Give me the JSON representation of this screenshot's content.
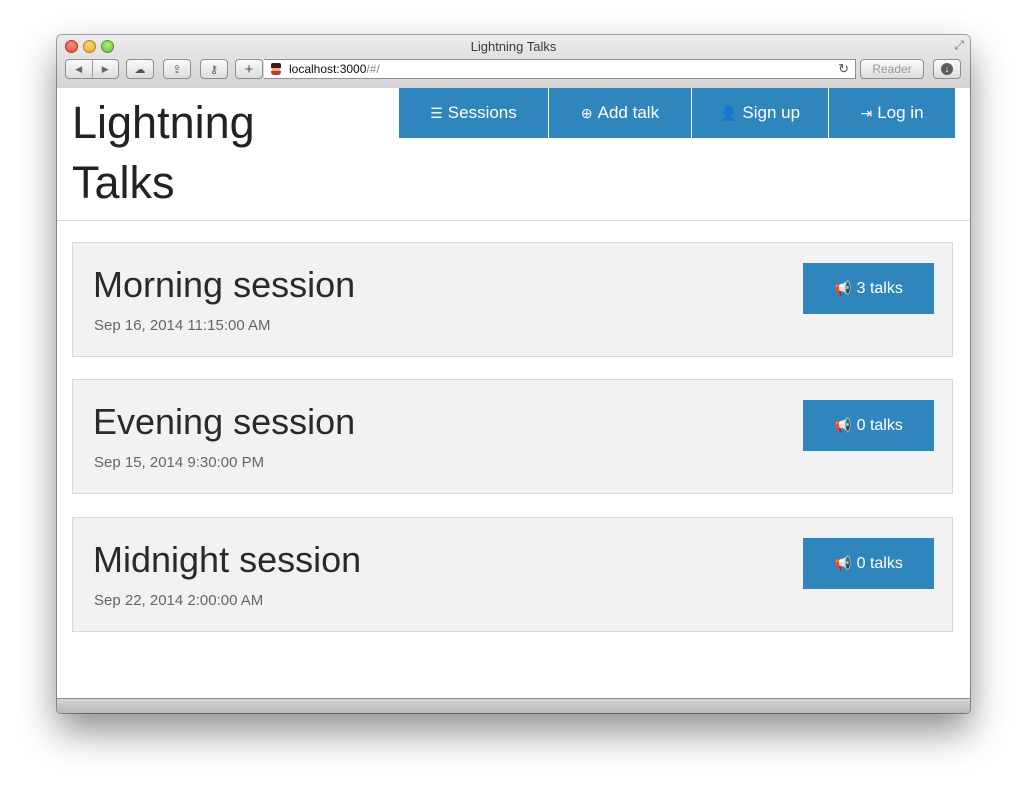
{
  "window": {
    "title": "Lightning Talks",
    "address_host": "localhost:3000",
    "address_path": "/#/",
    "reader_label": "Reader"
  },
  "icons": {
    "back": "◀",
    "forward": "▶",
    "cloud": "☁",
    "share": "⇪",
    "key": "⚷",
    "plus": "+",
    "reload": "↻",
    "download": "↓",
    "fullscreen": "⤢",
    "list": "☰",
    "plus_circle": "⊕",
    "user": "👤",
    "login": "⇥",
    "megaphone": "📢"
  },
  "header": {
    "brand": "Lightning Talks"
  },
  "nav": [
    {
      "label": "Sessions",
      "icon": "list-icon"
    },
    {
      "label": "Add talk",
      "icon": "plus-circle-icon"
    },
    {
      "label": "Sign up",
      "icon": "user-icon"
    },
    {
      "label": "Log in",
      "icon": "login-icon"
    }
  ],
  "sessions": [
    {
      "name": "Morning session",
      "date": "Sep 16, 2014 11:15:00 AM",
      "talks": "3 talks"
    },
    {
      "name": "Evening session",
      "date": "Sep 15, 2014 9:30:00 PM",
      "talks": "0 talks"
    },
    {
      "name": "Midnight session",
      "date": "Sep 22, 2014 2:00:00 AM",
      "talks": "0 talks"
    }
  ],
  "colors": {
    "primary": "#2e86bc",
    "panel": "#f2f2f2"
  }
}
